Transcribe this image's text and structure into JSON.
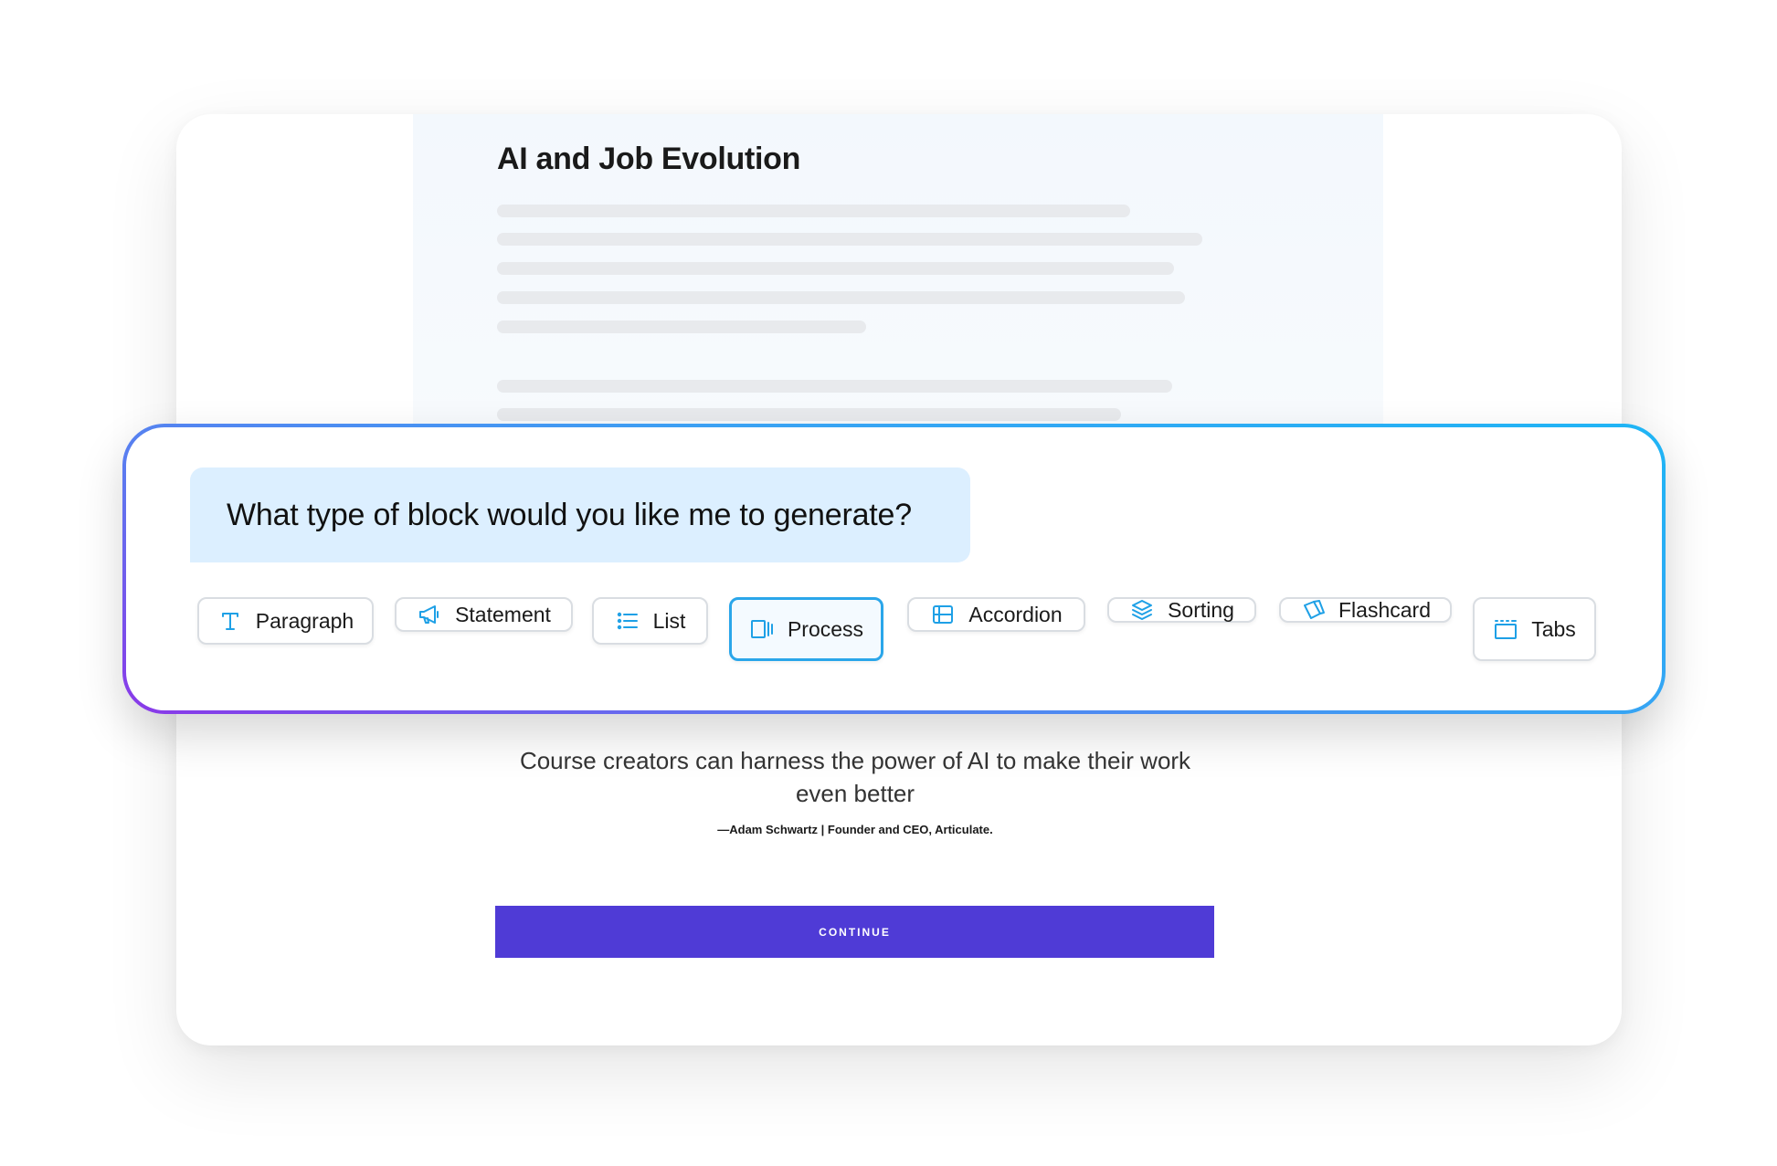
{
  "lesson": {
    "title": "AI and Job Evolution"
  },
  "ai_prompt": {
    "question": "What type of block would you like me to generate?",
    "options": [
      {
        "label": "Paragraph",
        "icon": "text-t-icon"
      },
      {
        "label": "Statement",
        "icon": "megaphone-icon"
      },
      {
        "label": "List",
        "icon": "bulleted-list-icon"
      },
      {
        "label": "Process",
        "icon": "process-steps-icon",
        "selected": true
      },
      {
        "label": "Accordion",
        "icon": "accordion-icon"
      },
      {
        "label": "Sorting",
        "icon": "stacked-layers-icon"
      },
      {
        "label": "Flashcard",
        "icon": "flashcard-icon"
      },
      {
        "label": "Tabs",
        "icon": "tabs-icon"
      }
    ]
  },
  "quote": {
    "text": "Course creators can harness the power of AI to make their work even better",
    "attribution": "—Adam Schwartz | Founder and CEO, Articulate."
  },
  "continue_button": {
    "label": "CONTINUE"
  },
  "colors": {
    "accent_blue": "#1ea0e6",
    "bubble_bg": "#dcefff",
    "continue_bg": "#4f3bd6",
    "gradient_top": "#1fb5f5",
    "gradient_bottom": "#8a38e8"
  }
}
